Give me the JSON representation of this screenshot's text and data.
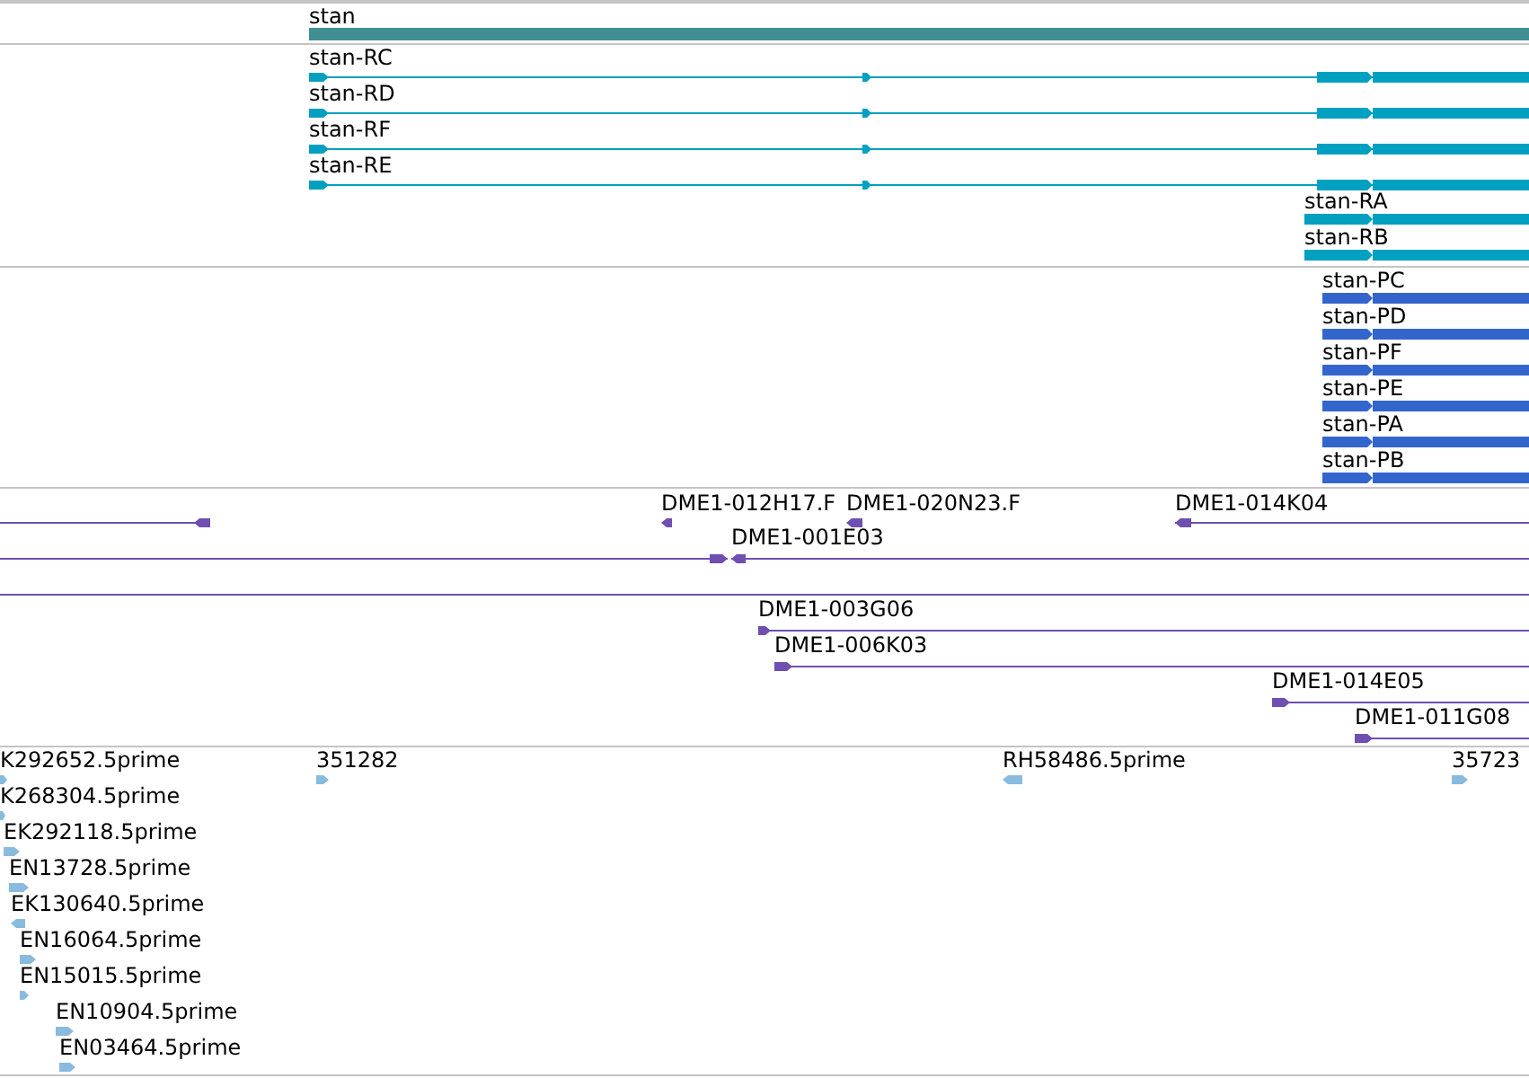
{
  "tracks": [
    {
      "kind": "gene",
      "features": [
        {
          "label": "stan"
        }
      ]
    },
    {
      "kind": "transcript",
      "features": [
        {
          "label": "stan-RC",
          "reverse": false
        },
        {
          "label": "stan-RD",
          "reverse": false
        },
        {
          "label": "stan-RF",
          "reverse": false
        },
        {
          "label": "stan-RE",
          "reverse": false
        },
        {
          "label": "stan-RA",
          "reverse": false
        },
        {
          "label": "stan-RB",
          "reverse": false
        }
      ]
    },
    {
      "kind": "protein",
      "features": [
        {
          "label": "stan-PC",
          "reverse": false
        },
        {
          "label": "stan-PD",
          "reverse": false
        },
        {
          "label": "stan-PF",
          "reverse": false
        },
        {
          "label": "stan-PE",
          "reverse": false
        },
        {
          "label": "stan-PA",
          "reverse": false
        },
        {
          "label": "stan-PB",
          "reverse": false
        }
      ]
    },
    {
      "kind": "clone",
      "features": [
        {
          "reverse": true
        },
        {
          "label": "DME1-012H17.F",
          "reverse": true
        },
        {
          "label": "DME1-020N23.F",
          "reverse": true
        },
        {
          "label": "DME1-014K04",
          "reverse": true
        },
        {
          "reverse": false
        },
        {
          "label": "DME1-001E03",
          "reverse": true
        },
        {
          "arrowhead": false
        },
        {
          "label": "DME1-003G06",
          "reverse": false
        },
        {
          "label": "DME1-006K03",
          "reverse": false
        },
        {
          "label": "DME1-014E05",
          "reverse": false
        },
        {
          "label": "DME1-011G08",
          "reverse": false
        }
      ]
    },
    {
      "kind": "est",
      "features": [
        {
          "label": "K292652.5prime",
          "reverse": false
        },
        {
          "label": "K268304.5prime",
          "reverse": false
        },
        {
          "label": "EK292118.5prime",
          "reverse": false
        },
        {
          "label": "EN13728.5prime",
          "reverse": false
        },
        {
          "label": "EK130640.5prime",
          "reverse": true
        },
        {
          "label": "EN16064.5prime",
          "reverse": false
        },
        {
          "label": "EN15015.5prime",
          "reverse": false
        },
        {
          "label": "EN10904.5prime",
          "reverse": false
        },
        {
          "label": "EN03464.5prime",
          "reverse": false
        },
        {
          "label": "351282",
          "reverse": false
        },
        {
          "label": "RH58486.5prime",
          "reverse": true
        },
        {
          "label": "35723",
          "reverse": false
        }
      ]
    }
  ]
}
